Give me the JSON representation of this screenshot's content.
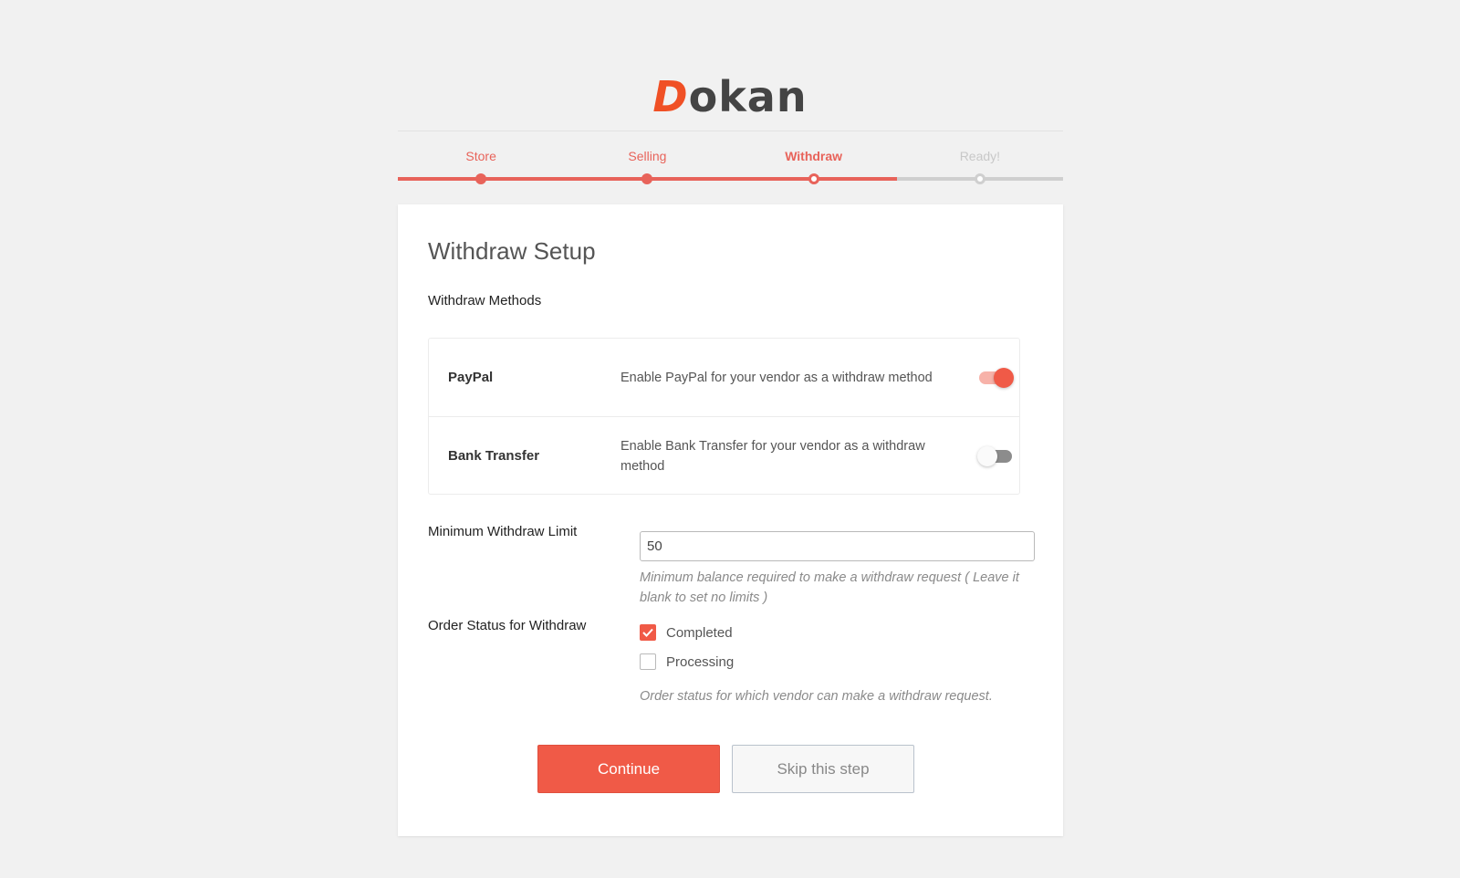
{
  "logo": {
    "first_letter": "D",
    "rest": "okan"
  },
  "steps": [
    {
      "label": "Store",
      "state": "done"
    },
    {
      "label": "Selling",
      "state": "done"
    },
    {
      "label": "Withdraw",
      "state": "active"
    },
    {
      "label": "Ready!",
      "state": "todo"
    }
  ],
  "colors": {
    "accent": "#f05a47",
    "step_accent": "#e8635a",
    "inactive": "#cfcfcf",
    "background": "#f1f1f1"
  },
  "card": {
    "title": "Withdraw Setup",
    "methods_label": "Withdraw Methods",
    "methods": [
      {
        "name": "PayPal",
        "description": "Enable PayPal for your vendor as a withdraw method",
        "enabled": true
      },
      {
        "name": "Bank Transfer",
        "description": "Enable Bank Transfer for your vendor as a withdraw method",
        "enabled": false
      }
    ],
    "min_limit": {
      "label": "Minimum Withdraw Limit",
      "value": "50",
      "help": "Minimum balance required to make a withdraw request ( Leave it blank to set no limits )"
    },
    "order_status": {
      "label": "Order Status for Withdraw",
      "options": [
        {
          "label": "Completed",
          "checked": true
        },
        {
          "label": "Processing",
          "checked": false
        }
      ],
      "help": "Order status for which vendor can make a withdraw request."
    },
    "buttons": {
      "continue": "Continue",
      "skip": "Skip this step"
    }
  }
}
